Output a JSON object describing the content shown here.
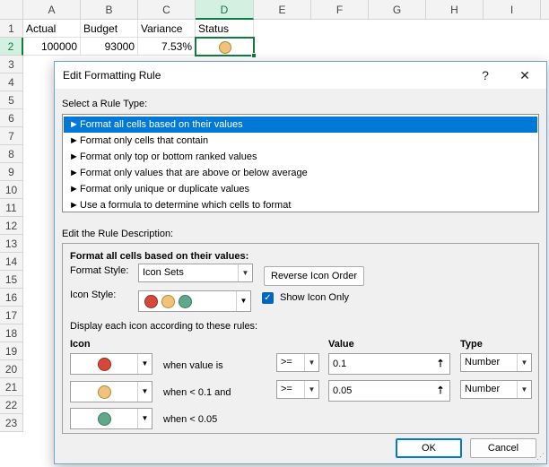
{
  "sheet": {
    "columns": [
      "A",
      "B",
      "C",
      "D",
      "E",
      "F",
      "G",
      "H",
      "I"
    ],
    "rows": [
      "1",
      "2",
      "3",
      "4",
      "5",
      "6",
      "7",
      "8",
      "9",
      "10",
      "11",
      "12",
      "13",
      "14",
      "15",
      "16",
      "17",
      "18",
      "19",
      "20",
      "21",
      "22",
      "23"
    ],
    "cells": {
      "a1": "Actual",
      "b1": "Budget",
      "c1": "Variance",
      "d1": "Status",
      "a2": "100000",
      "b2": "93000",
      "c2": "7.53%"
    },
    "status_icon_color": "#f0c27a"
  },
  "dialog": {
    "title": "Edit Formatting Rule",
    "help": "?",
    "close": "✕",
    "select_rule_type_label": "Select a Rule Type:",
    "rule_types": [
      "Format all cells based on their values",
      "Format only cells that contain",
      "Format only top or bottom ranked values",
      "Format only values that are above or below average",
      "Format only unique or duplicate values",
      "Use a formula to determine which cells to format"
    ],
    "rule_arrow": "►",
    "edit_desc_label": "Edit the Rule Description:",
    "format_all_label": "Format all cells based on their values:",
    "format_style_label": "Format Style:",
    "format_style_value": "Icon Sets",
    "reverse_icon_order": "Reverse Icon Order",
    "icon_style_label": "Icon Style:",
    "show_icon_only": "Show Icon Only",
    "show_icon_only_checked": true,
    "display_rules_label": "Display each icon according to these rules:",
    "col_icon": "Icon",
    "col_value": "Value",
    "col_type": "Type",
    "rules": [
      {
        "icon_color": "#d4493a",
        "condition_text": "when value is",
        "operator": ">=",
        "value": "0.1",
        "type": "Number"
      },
      {
        "icon_color": "#f0c27a",
        "condition_text": "when < 0.1 and",
        "operator": ">=",
        "value": "0.05",
        "type": "Number"
      },
      {
        "icon_color": "#5fa88a",
        "condition_text": "when < 0.05"
      }
    ],
    "icon_style_colors": [
      "#d4493a",
      "#f0c27a",
      "#5fa88a"
    ],
    "ok": "OK",
    "cancel": "Cancel"
  }
}
